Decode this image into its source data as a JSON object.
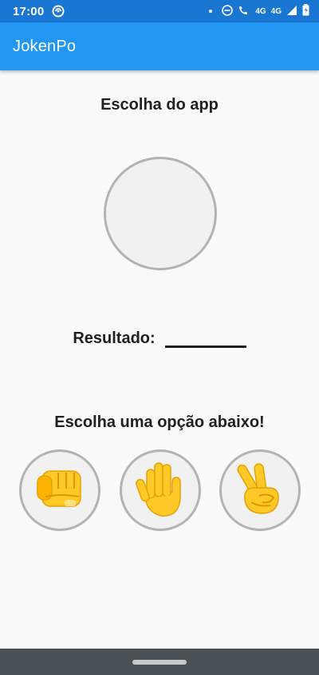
{
  "status_bar": {
    "time": "17:00",
    "network_label": "4G",
    "call_network_label": "4G"
  },
  "app_bar": {
    "title": "JokenPo"
  },
  "app_choice": {
    "heading": "Escolha do app",
    "image": "empty-circle"
  },
  "result": {
    "label": "Resultado:",
    "value": ""
  },
  "options": {
    "heading": "Escolha uma opção abaixo!",
    "items": [
      {
        "icon": "fist-icon",
        "meaning": "pedra"
      },
      {
        "icon": "open-hand-icon",
        "meaning": "papel"
      },
      {
        "icon": "victory-hand-icon",
        "meaning": "tesoura"
      }
    ]
  },
  "colors": {
    "status_bar": "#1976d2",
    "app_bar": "#2196f3",
    "background": "#fafafa",
    "circle_border": "#b3b3b3",
    "circle_fill": "#f1f1f1",
    "emoji_skin": "#ffca28",
    "nav_bar": "#4a5157"
  }
}
